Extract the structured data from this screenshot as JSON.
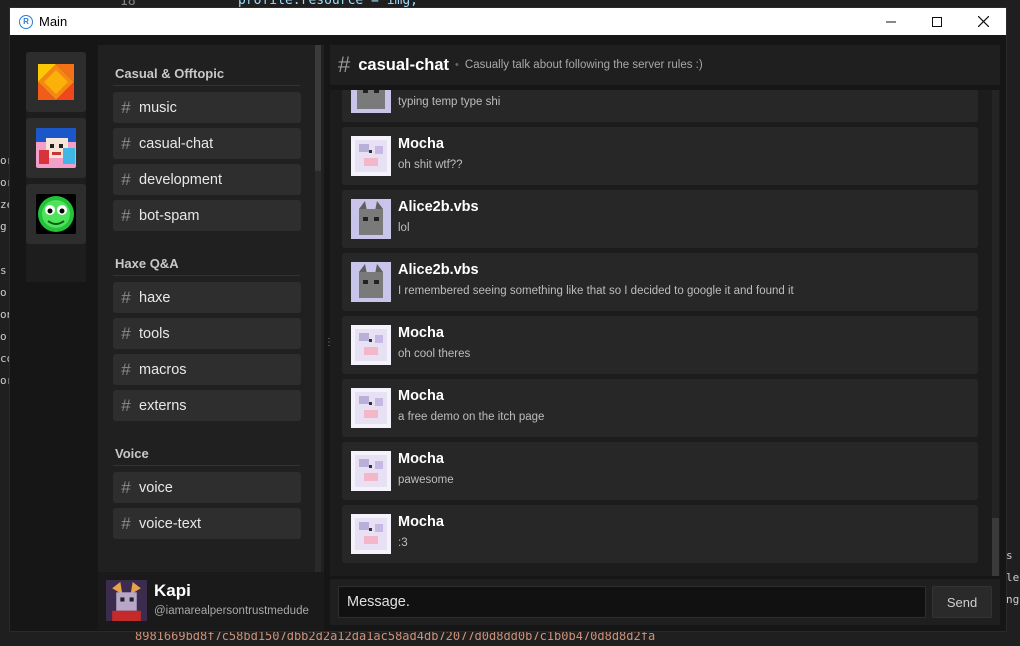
{
  "window": {
    "title": "Main"
  },
  "background_editor": {
    "line_number": "18",
    "code": "profile.resource = img;",
    "bottom_line": "8981669bd8f7c58bd1507dbb2d2a12da1ac58ad4db72077d0d8dd0b7c1b0b470d8d8d2fa"
  },
  "servers": [
    {
      "name": "haxe",
      "icon": "haxe-logo-icon"
    },
    {
      "name": "fnf",
      "icon": "boyfriend-avatar-icon"
    },
    {
      "name": "slime",
      "icon": "green-slime-icon"
    }
  ],
  "channels": {
    "categories": [
      {
        "name": "Casual & Offtopic",
        "items": [
          "music",
          "casual-chat",
          "development",
          "bot-spam"
        ]
      },
      {
        "name": "Haxe Q&A",
        "items": [
          "haxe",
          "tools",
          "macros",
          "externs"
        ]
      },
      {
        "name": "Voice",
        "items": [
          "voice",
          "voice-text"
        ]
      }
    ]
  },
  "user": {
    "name": "Kapi",
    "handle": "@iamarealpersontrustmedude"
  },
  "chat": {
    "channel_name": "casual-chat",
    "topic": "Casually talk about following the server rules :)",
    "messages": [
      {
        "author": "",
        "text": "typing temp type shi"
      },
      {
        "author": "Mocha",
        "text": "oh shit wtf??"
      },
      {
        "author": "Alice2b.vbs",
        "text": "lol"
      },
      {
        "author": "Alice2b.vbs",
        "text": "I remembered seeing something like that so I decided to google it and found it"
      },
      {
        "author": "Mocha",
        "text": "oh cool theres"
      },
      {
        "author": "Mocha",
        "text": "a free demo on the itch page"
      },
      {
        "author": "Mocha",
        "text": "pawesome"
      },
      {
        "author": "Mocha",
        "text": ":3"
      }
    ]
  },
  "composer": {
    "placeholder": "Message.",
    "send_label": "Send"
  },
  "colors": {
    "accent": "#2b7bd8",
    "panel": "#202020",
    "message_bg": "#272727"
  }
}
